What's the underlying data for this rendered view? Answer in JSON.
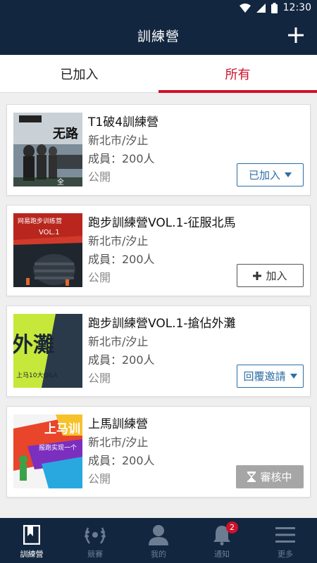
{
  "status_bar": {
    "time": "12:30"
  },
  "app_bar": {
    "title": "訓練營"
  },
  "tabs": [
    {
      "label": "已加入",
      "active": false
    },
    {
      "label": "所有",
      "active": true
    }
  ],
  "camps": [
    {
      "name": "T1破4訓練營",
      "location": "新北市/汐止",
      "members": "成員：200人",
      "visibility": "公開",
      "action": {
        "type": "joined",
        "label": "已加入"
      },
      "thumb_text": [
        "无路",
        "全"
      ]
    },
    {
      "name": "跑步訓練營VOL.1-征服北馬",
      "location": "新北市/汐止",
      "members": "成員：200人",
      "visibility": "公開",
      "action": {
        "type": "add",
        "label": "加入"
      },
      "thumb_text": [
        "网易跑步训练营",
        "VOL.1"
      ]
    },
    {
      "name": "跑步訓練營VOL.1-搶佔外灘",
      "location": "新北市/汐止",
      "members": "成員：200人",
      "visibility": "公開",
      "action": {
        "type": "reply",
        "label": "回覆邀請"
      },
      "thumb_text": [
        "外灘",
        "上马10大Q&A"
      ]
    },
    {
      "name": "上馬訓練營",
      "location": "新北市/汐止",
      "members": "成員：200人",
      "visibility": "公開",
      "action": {
        "type": "pending",
        "label": "審核中"
      },
      "thumb_text": [
        "上马训",
        "报跑实现一个"
      ]
    }
  ],
  "bottom_nav": [
    {
      "label": "訓練營",
      "icon": "bookmark-icon",
      "active": true
    },
    {
      "label": "競賽",
      "icon": "laurel-icon",
      "active": false
    },
    {
      "label": "我的",
      "icon": "person-icon",
      "active": false
    },
    {
      "label": "通知",
      "icon": "bell-icon",
      "active": false,
      "badge": "2"
    },
    {
      "label": "更多",
      "icon": "menu-icon",
      "active": false
    }
  ],
  "colors": {
    "primary": "#12263f",
    "accent": "#d0112b",
    "link": "#2e6ea6"
  }
}
